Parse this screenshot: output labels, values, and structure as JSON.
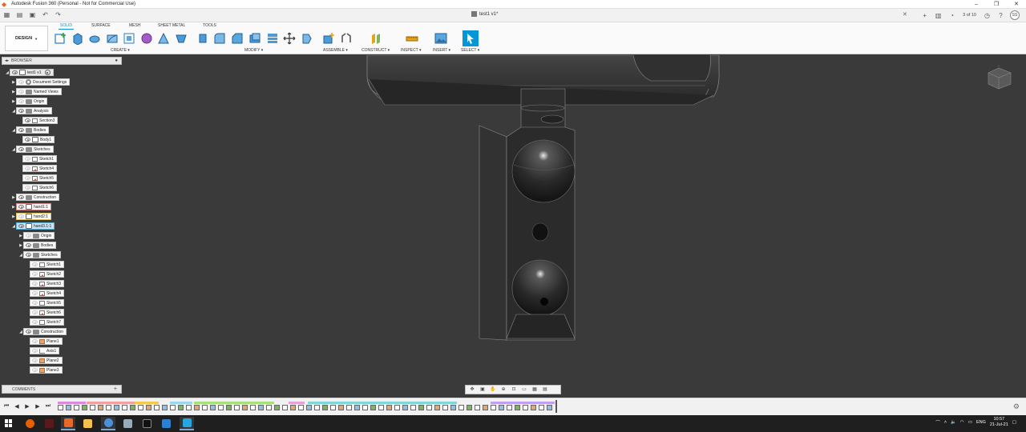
{
  "window": {
    "title": "Autodesk Fusion 360 (Personal - Not for Commercial Use)",
    "minimize": "–",
    "maximize": "❐",
    "close": "✕"
  },
  "tabbar": {
    "document_tab": "test1 v1*",
    "close": "✕",
    "job_status": "3 of 10",
    "avatar": "SS"
  },
  "toolbar": {
    "workspace": "DESIGN",
    "tabs": [
      "SOLID",
      "SURFACE",
      "MESH",
      "SHEET METAL",
      "TOOLS"
    ],
    "groups": [
      "CREATE ▾",
      "MODIFY ▾",
      "ASSEMBLE ▾",
      "CONSTRUCT ▾",
      "INSPECT ▾",
      "INSERT ▾",
      "SELECT ▾"
    ]
  },
  "browser": {
    "title": "BROWSER",
    "nodes": [
      {
        "label": "test1 v1",
        "kind": "root"
      },
      {
        "label": "Document Settings",
        "kind": "gear"
      },
      {
        "label": "Named Views",
        "kind": "folder"
      },
      {
        "label": "Origin",
        "kind": "folder"
      },
      {
        "label": "Analysis",
        "kind": "folder"
      },
      {
        "label": "Section3",
        "kind": "sketch"
      },
      {
        "label": "Bodies",
        "kind": "folder"
      },
      {
        "label": "Body1",
        "kind": "body"
      },
      {
        "label": "Sketches",
        "kind": "folder"
      },
      {
        "label": "Sketch1",
        "kind": "sketch"
      },
      {
        "label": "Sketch4",
        "kind": "sketch"
      },
      {
        "label": "Sketch5",
        "kind": "sketch"
      },
      {
        "label": "Sketch6",
        "kind": "sketch"
      },
      {
        "label": "Construction",
        "kind": "folder"
      },
      {
        "label": "hand1:1",
        "kind": "comp"
      },
      {
        "label": "hand2:1",
        "kind": "comp"
      },
      {
        "label": "hand3.1:1",
        "kind": "comp"
      },
      {
        "label": "Origin",
        "kind": "folder"
      },
      {
        "label": "Bodies",
        "kind": "folder"
      },
      {
        "label": "Sketches",
        "kind": "folder"
      },
      {
        "label": "Sketch1",
        "kind": "sketch"
      },
      {
        "label": "Sketch2",
        "kind": "sketch"
      },
      {
        "label": "Sketch3",
        "kind": "sketch"
      },
      {
        "label": "Sketch4",
        "kind": "sketch"
      },
      {
        "label": "Sketch5",
        "kind": "sketch"
      },
      {
        "label": "Sketch6",
        "kind": "sketch"
      },
      {
        "label": "Sketch7",
        "kind": "sketch"
      },
      {
        "label": "Construction",
        "kind": "folder"
      },
      {
        "label": "Plane1",
        "kind": "plane"
      },
      {
        "label": "Axis1",
        "kind": "axis"
      },
      {
        "label": "Plane2",
        "kind": "plane"
      },
      {
        "label": "Plane3",
        "kind": "plane"
      }
    ]
  },
  "comments": {
    "title": "COMMENTS",
    "add": "+"
  },
  "taskbar": {
    "language": "ENG",
    "time": "10:57",
    "date": "21-Jul-21"
  },
  "colors": {
    "accent": "#0696d7",
    "viewport": "#3a3a3a",
    "model": "#2b2b2b"
  }
}
